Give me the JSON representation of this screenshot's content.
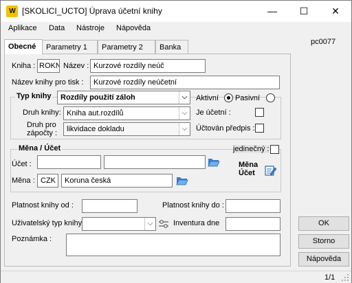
{
  "window": {
    "title": "[SKOLICI_UCTO] Úprava účetní knihy",
    "app_icon_text": "W",
    "minimize_glyph": "—",
    "maximize_glyph": "☐",
    "close_glyph": "✕"
  },
  "menu": [
    "Aplikace",
    "Data",
    "Nástroje",
    "Nápověda"
  ],
  "code_label": "pc0077",
  "tabs": [
    {
      "label": "Obecné",
      "active": true
    },
    {
      "label": "Parametry 1",
      "active": false
    },
    {
      "label": "Parametry 2",
      "active": false
    },
    {
      "label": "Banka",
      "active": false
    }
  ],
  "form": {
    "kniha_label": "Kniha :",
    "kniha_value": "ROKN",
    "nazev_label": "Název :",
    "nazev_value": "Kurzové rozdíly neúč",
    "nazev_tisk_label": "Název knihy pro tisk :",
    "nazev_tisk_value": "Kurzové rozdíly neúčetní",
    "typ_group_label": "Typ knihy",
    "typ_value": "Rozdíly použití záloh",
    "aktivni_label": "Aktivní",
    "pasivni_label": "Pasivní",
    "druh_label": "Druh knihy:",
    "druh_value": "Kniha aut.rozdílů",
    "druh_zapocty_label_1": "Druh pro",
    "druh_zapocty_label_2": "zápočty :",
    "druh_zapocty_value": "likvidace dokladu",
    "je_ucetni_label": "Je účetní :",
    "uctovan_label": "Účtován předpis :",
    "mena_group_label": "Měna / Účet",
    "jedinecny_label": "jedinečný :",
    "ucet_label": "Účet :",
    "ucet_value_1": "",
    "ucet_value_2": "",
    "mena_label": "Měna :",
    "mena_code": "CZK",
    "mena_name": "Koruna česká",
    "mena_ucet_label_1": "Měna",
    "mena_ucet_label_2": "Účet",
    "platnost_od_label": "Platnost knihy od :",
    "platnost_od_value": "",
    "platnost_do_label": "Platnost knihy do :",
    "platnost_do_value": "",
    "uzivatelsky_typ_label": "Uživatelský typ knihy",
    "uzivatelsky_typ_value": "",
    "inventura_label": "Inventura dne",
    "inventura_value": "",
    "poznamka_label": "Poznámka :",
    "poznamka_value": ""
  },
  "buttons": {
    "ok": "OK",
    "storno": "Storno",
    "napoveda": "Nápověda"
  },
  "status": {
    "page": "1/1"
  },
  "colors": {
    "app_icon_bg": "#f2c200",
    "window_bg": "#f0f0f0"
  }
}
